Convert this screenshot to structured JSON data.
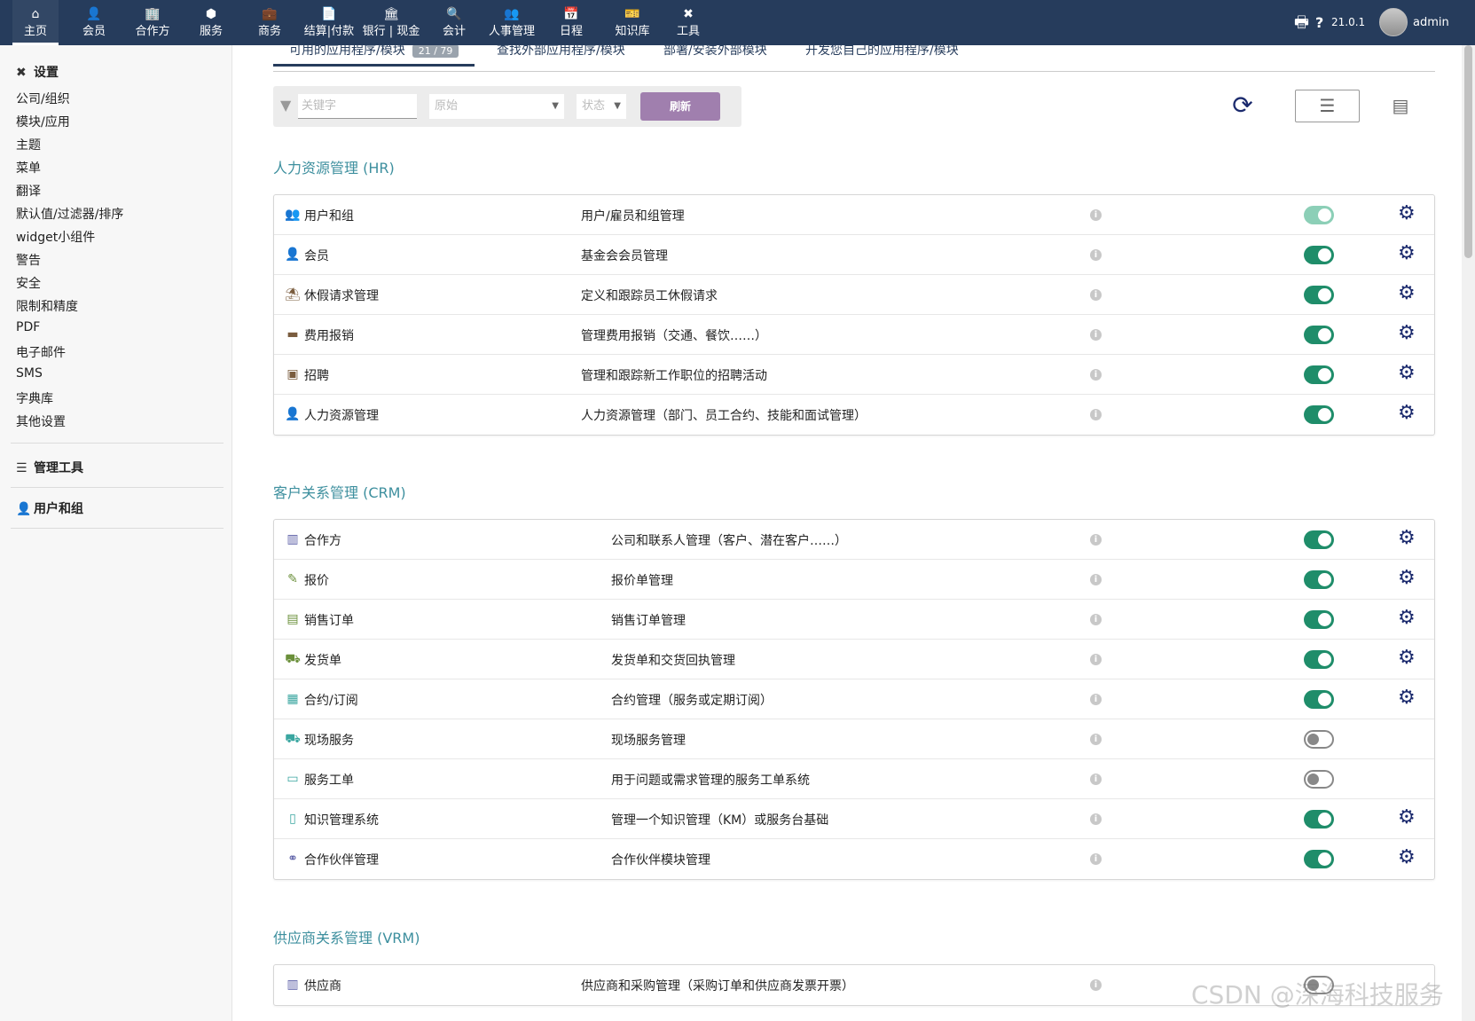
{
  "topnav": {
    "items": [
      {
        "label": "主页",
        "icon": "⌂"
      },
      {
        "label": "会员",
        "icon": "👤"
      },
      {
        "label": "合作方",
        "icon": "🏢"
      },
      {
        "label": "服务",
        "icon": "⬢"
      },
      {
        "label": "商务",
        "icon": "💼"
      },
      {
        "label": "结算|付款",
        "icon": "📄"
      },
      {
        "label": "银行 | 现金",
        "icon": "🏛"
      },
      {
        "label": "会计",
        "icon": "🔍"
      },
      {
        "label": "人事管理",
        "icon": "👥"
      },
      {
        "label": "日程",
        "icon": "📅"
      },
      {
        "label": "知识库",
        "icon": "🎫"
      },
      {
        "label": "工具",
        "icon": "✖"
      }
    ],
    "version": "21.0.1",
    "user": "admin",
    "print_icon": "🖶",
    "help_icon": "?"
  },
  "sidebar": {
    "settings_title": "设置",
    "settings_items": [
      "公司/组织",
      "模块/应用",
      "主题",
      "菜单",
      "翻译",
      "默认值/过滤器/排序",
      "widget小组件",
      "警告",
      "安全",
      "限制和精度",
      "PDF",
      "电子邮件",
      "SMS",
      "字典库",
      "其他设置"
    ],
    "admin_tools_title": "管理工具",
    "users_groups_title": "用户和组"
  },
  "tabs": [
    {
      "label": "可用的应用程序/模块",
      "badge": "21 / 79"
    },
    {
      "label": "查找外部应用程序/模块"
    },
    {
      "label": "部署/安装外部模块"
    },
    {
      "label": "开发您自己的应用程序/模块"
    }
  ],
  "filters": {
    "keyword_placeholder": "关键字",
    "origin_placeholder": "原始",
    "status_placeholder": "状态",
    "refresh_label": "刷新"
  },
  "groups": [
    {
      "title": "人力资源管理 (HR)",
      "modules": [
        {
          "name": "用户和组",
          "desc": "用户/雇员和组管理",
          "icon": "👥",
          "color": "#7a5c3e",
          "status": "faded",
          "config": true
        },
        {
          "name": "会员",
          "desc": "基金会会员管理",
          "icon": "👤",
          "color": "#7a5c3e",
          "status": "on",
          "config": true
        },
        {
          "name": "休假请求管理",
          "desc": "定义和跟踪员工休假请求",
          "icon": "⛱",
          "color": "#7a5c3e",
          "status": "on",
          "config": true
        },
        {
          "name": "费用报销",
          "desc": "管理费用报销（交通、餐饮……）",
          "icon": "▬",
          "color": "#7a5c3e",
          "status": "on",
          "config": true
        },
        {
          "name": "招聘",
          "desc": "管理和跟踪新工作职位的招聘活动",
          "icon": "▣",
          "color": "#7a5c3e",
          "status": "on",
          "config": true
        },
        {
          "name": "人力资源管理",
          "desc": "人力资源管理（部门、员工合约、技能和面试管理）",
          "icon": "👤",
          "color": "#7a5c3e",
          "status": "on",
          "config": true
        }
      ]
    },
    {
      "title": "客户关系管理 (CRM)",
      "modules": [
        {
          "name": "合作方",
          "desc": "公司和联系人管理（客户、潜在客户……）",
          "icon": "▥",
          "color": "#5b5ea6",
          "status": "on",
          "config": true
        },
        {
          "name": "报价",
          "desc": "报价单管理",
          "icon": "✎",
          "color": "#6a8f3a",
          "status": "on",
          "config": true
        },
        {
          "name": "销售订单",
          "desc": "销售订单管理",
          "icon": "▤",
          "color": "#6a8f3a",
          "status": "on",
          "config": true
        },
        {
          "name": "发货单",
          "desc": "发货单和交货回执管理",
          "icon": "⛟",
          "color": "#6a8f3a",
          "status": "on",
          "config": true
        },
        {
          "name": "合约/订阅",
          "desc": "合约管理（服务或定期订阅）",
          "icon": "▦",
          "color": "#3aa6a0",
          "status": "on",
          "config": true
        },
        {
          "name": "现场服务",
          "desc": "现场服务管理",
          "icon": "⛟",
          "color": "#3aa6a0",
          "status": "off",
          "config": false
        },
        {
          "name": "服务工单",
          "desc": "用于问题或需求管理的服务工单系统",
          "icon": "▭",
          "color": "#3aa6a0",
          "status": "off",
          "config": false
        },
        {
          "name": "知识管理系统",
          "desc": "管理一个知识管理（KM）或服务台基础",
          "icon": "▯",
          "color": "#3aa6a0",
          "status": "on",
          "config": true
        },
        {
          "name": "合作伙伴管理",
          "desc": "合作伙伴模块管理",
          "icon": "⚭",
          "color": "#5b5ea6",
          "status": "on",
          "config": true
        }
      ]
    },
    {
      "title": "供应商关系管理 (VRM)",
      "modules": [
        {
          "name": "供应商",
          "desc": "供应商和采购管理（采购订单和供应商发票开票）",
          "icon": "▥",
          "color": "#5b5ea6",
          "status": "off",
          "config": false
        }
      ]
    }
  ],
  "colors": {
    "navbar": "#263c5c",
    "accent_toggle": "#1f8d6a",
    "gear": "#1c2b6e",
    "group_title": "#3d8f9e"
  },
  "watermark": "CSDN @深海科技服务"
}
